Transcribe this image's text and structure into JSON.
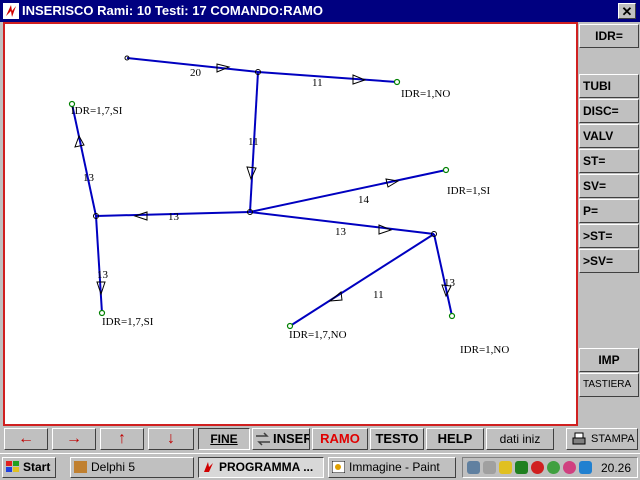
{
  "window": {
    "title": "INSERISCO   Rami:    10 Testi: 17 COMANDO:RAMO",
    "close_glyph": "✕"
  },
  "diagram": {
    "edge_labels": [
      "20",
      "11",
      "11",
      "13",
      "13",
      "13",
      "14",
      "13",
      "11",
      "13"
    ],
    "node_labels": [
      "IDR=1,NO",
      "IDR=1,7,SI",
      "IDR=1,SI",
      "IDR=1,7,SI",
      "IDR=1,7,NO",
      "IDR=1,NO"
    ],
    "line_color": "#0000c0",
    "border_color": "#d02020"
  },
  "right_panel": {
    "buttons": [
      "IDR=",
      "TUBI",
      "DISC=",
      "VALV",
      "ST=",
      "SV=",
      "P=",
      ">ST=",
      ">SV=",
      "IMP",
      "TASTIERA"
    ]
  },
  "bottom_bar": {
    "arrows": [
      "←",
      "→",
      "↑",
      "↓"
    ],
    "fine": "FINE",
    "inser": "INSER",
    "ramo": "RAMO",
    "testo": "TESTO",
    "help": "HELP",
    "dati": "dati iniz",
    "stampa": "STAMPA"
  },
  "taskbar": {
    "start": "Start",
    "tasks": [
      "Delphi 5",
      "PROGRAMMA ...",
      "Immagine - Paint"
    ],
    "clock": "20.26"
  }
}
